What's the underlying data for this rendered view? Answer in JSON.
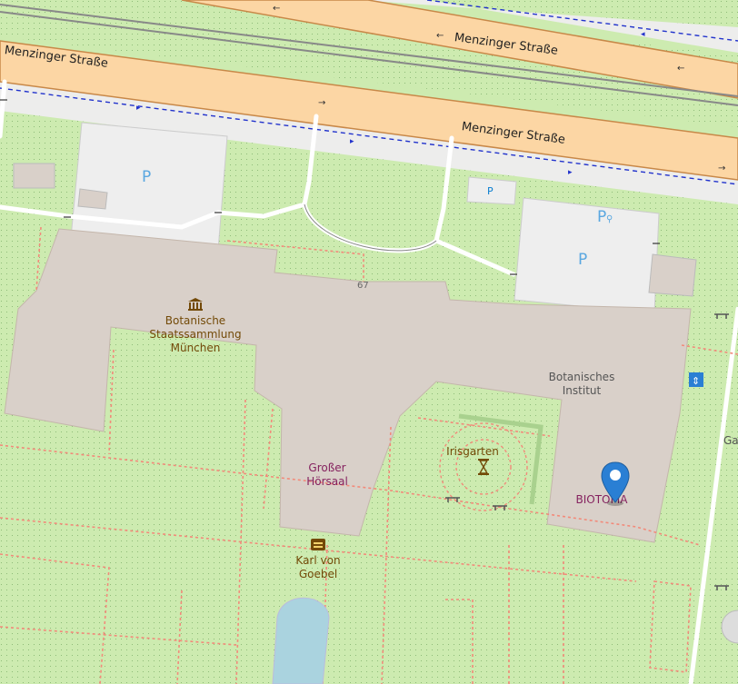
{
  "map": {
    "roads": [
      {
        "name": "Menzinger Straße"
      },
      {
        "name": "Menzinger Straße"
      },
      {
        "name": "Menzinger Straße"
      }
    ],
    "pois": {
      "museum": {
        "label": "Botanische\nStaatssammlung\nMünchen",
        "icon": "museum-icon"
      },
      "institute": {
        "label": "Botanisches\nInstitut"
      },
      "hall": {
        "label": "Großer\nHörsaal"
      },
      "garden": {
        "label": "Irisgarten",
        "icon": "hourglass-icon"
      },
      "memorial": {
        "label": "Karl von\nGoebel",
        "icon": "memorial-icon"
      },
      "biotopia": {
        "label": "BIOTOPIA",
        "icon": "location-pin-icon"
      },
      "edge": {
        "label": "Ga"
      }
    },
    "house_number": "67",
    "parking": [
      "P",
      "P",
      "P",
      "P"
    ],
    "colors": {
      "road": "#fcd6a4",
      "road_casing": "#c88848",
      "park": "#cdebb0",
      "building": "#d9d0c9",
      "parking": "#eeeeee",
      "path": "#fa8072",
      "marker": "#2a7fd4",
      "water": "#aad3df"
    }
  }
}
